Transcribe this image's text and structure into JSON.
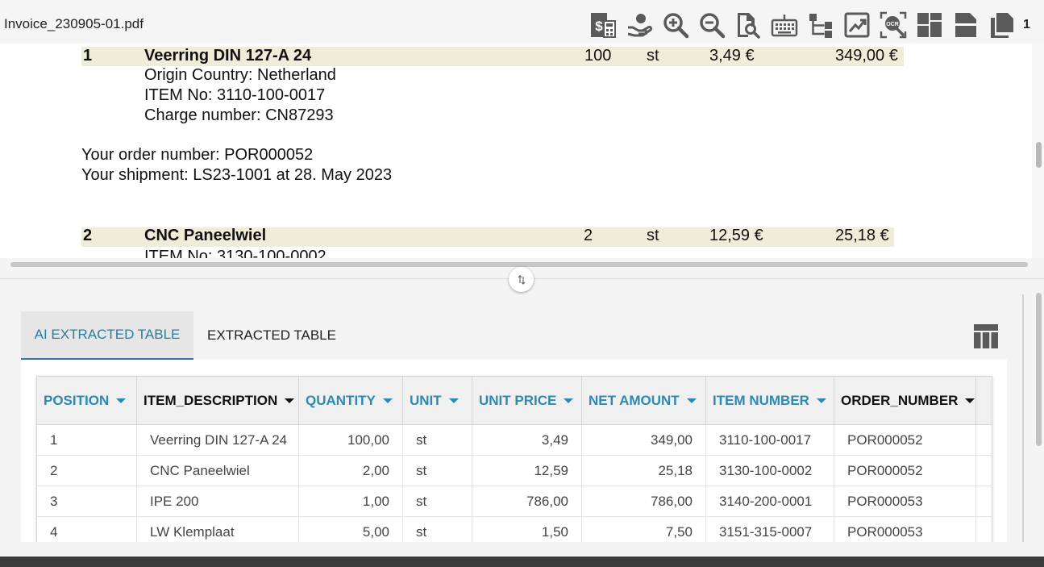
{
  "file": {
    "name": "Invoice_230905-01.pdf",
    "page_count": "1"
  },
  "toolbar": {
    "tools": [
      {
        "name": "invoice-calculator-icon"
      },
      {
        "name": "hand-coin-icon"
      },
      {
        "name": "zoom-in-icon"
      },
      {
        "name": "zoom-out-icon"
      },
      {
        "name": "document-search-icon"
      },
      {
        "name": "keyboard-icon"
      },
      {
        "name": "hierarchy-icon"
      },
      {
        "name": "chart-trend-icon"
      },
      {
        "name": "ocr-icon"
      },
      {
        "name": "layout-grid-icon"
      },
      {
        "name": "single-page-icon"
      },
      {
        "name": "multi-page-icon"
      }
    ]
  },
  "pdf": {
    "item1": {
      "pos": "1",
      "desc": "Veerring  DIN 127-A 24",
      "qty": "100",
      "unit": "st",
      "price": "3,49 €",
      "amount": "349,00 €"
    },
    "item1_lines": [
      "Origin Country: Netherland",
      "ITEM No: 3110-100-0017",
      "Charge number: CN87293"
    ],
    "order_lines": [
      "Your order number: POR000052",
      "Your shipment: LS23-1001 at 28. May 2023"
    ],
    "item2": {
      "pos": "2",
      "desc": "CNC Paneelwiel",
      "qty": "2",
      "unit": "st",
      "price": "12,59 €",
      "amount": "25,18 €"
    },
    "item2_partial": "ITEM No: 3130-100-0002"
  },
  "tabs": {
    "ai": "AI EXTRACTED TABLE",
    "extracted": "EXTRACTED TABLE"
  },
  "table": {
    "headers": [
      "POSITION",
      "ITEM_DESCRIPTION",
      "QUANTITY",
      "UNIT",
      "UNIT PRICE",
      "NET AMOUNT",
      "ITEM NUMBER",
      "ORDER_NUMBER"
    ],
    "header_styles": [
      "blue",
      "dark",
      "blue",
      "blue",
      "blue",
      "blue",
      "blue",
      "dark"
    ],
    "rows": [
      [
        "1",
        "Veerring DIN 127-A 24",
        "100,00",
        "st",
        "3,49",
        "349,00",
        "3110-100-0017",
        "POR000052"
      ],
      [
        "2",
        "CNC Paneelwiel",
        "2,00",
        "st",
        "12,59",
        "25,18",
        "3130-100-0002",
        "POR000052"
      ],
      [
        "3",
        "IPE 200",
        "1,00",
        "st",
        "786,00",
        "786,00",
        "3140-200-0001",
        "POR000053"
      ],
      [
        "4",
        "LW Klemplaat",
        "5,00",
        "st",
        "1,50",
        "7,50",
        "3151-315-0007",
        "POR000053"
      ]
    ]
  },
  "colors": {
    "accent": "#2b8ab4",
    "highlight": "#efedd9",
    "icon": "#5a5a5a"
  }
}
